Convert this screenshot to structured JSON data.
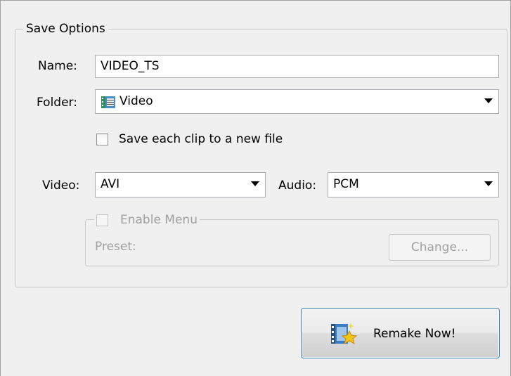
{
  "group": {
    "title": "Save Options"
  },
  "name_field": {
    "label": "Name:",
    "value": "VIDEO_TS"
  },
  "folder_field": {
    "label": "Folder:",
    "value": "Video",
    "icon": "film-folder-icon"
  },
  "save_each_clip": {
    "label": "Save each clip to a new file",
    "checked": false
  },
  "video_field": {
    "label": "Video:",
    "value": "AVI"
  },
  "audio_field": {
    "label": "Audio:",
    "value": "PCM"
  },
  "menu_group": {
    "enable_label": "Enable Menu",
    "checked": false,
    "preset_label": "Preset:",
    "change_label": "Change..."
  },
  "remake_button": {
    "label": "Remake Now!",
    "icon": "film-sparkle-icon"
  },
  "colors": {
    "background": "#f0f0f0",
    "border": "#abadb3",
    "disabled_text": "#a0a0a0",
    "button_border": "#3c7fb1"
  }
}
